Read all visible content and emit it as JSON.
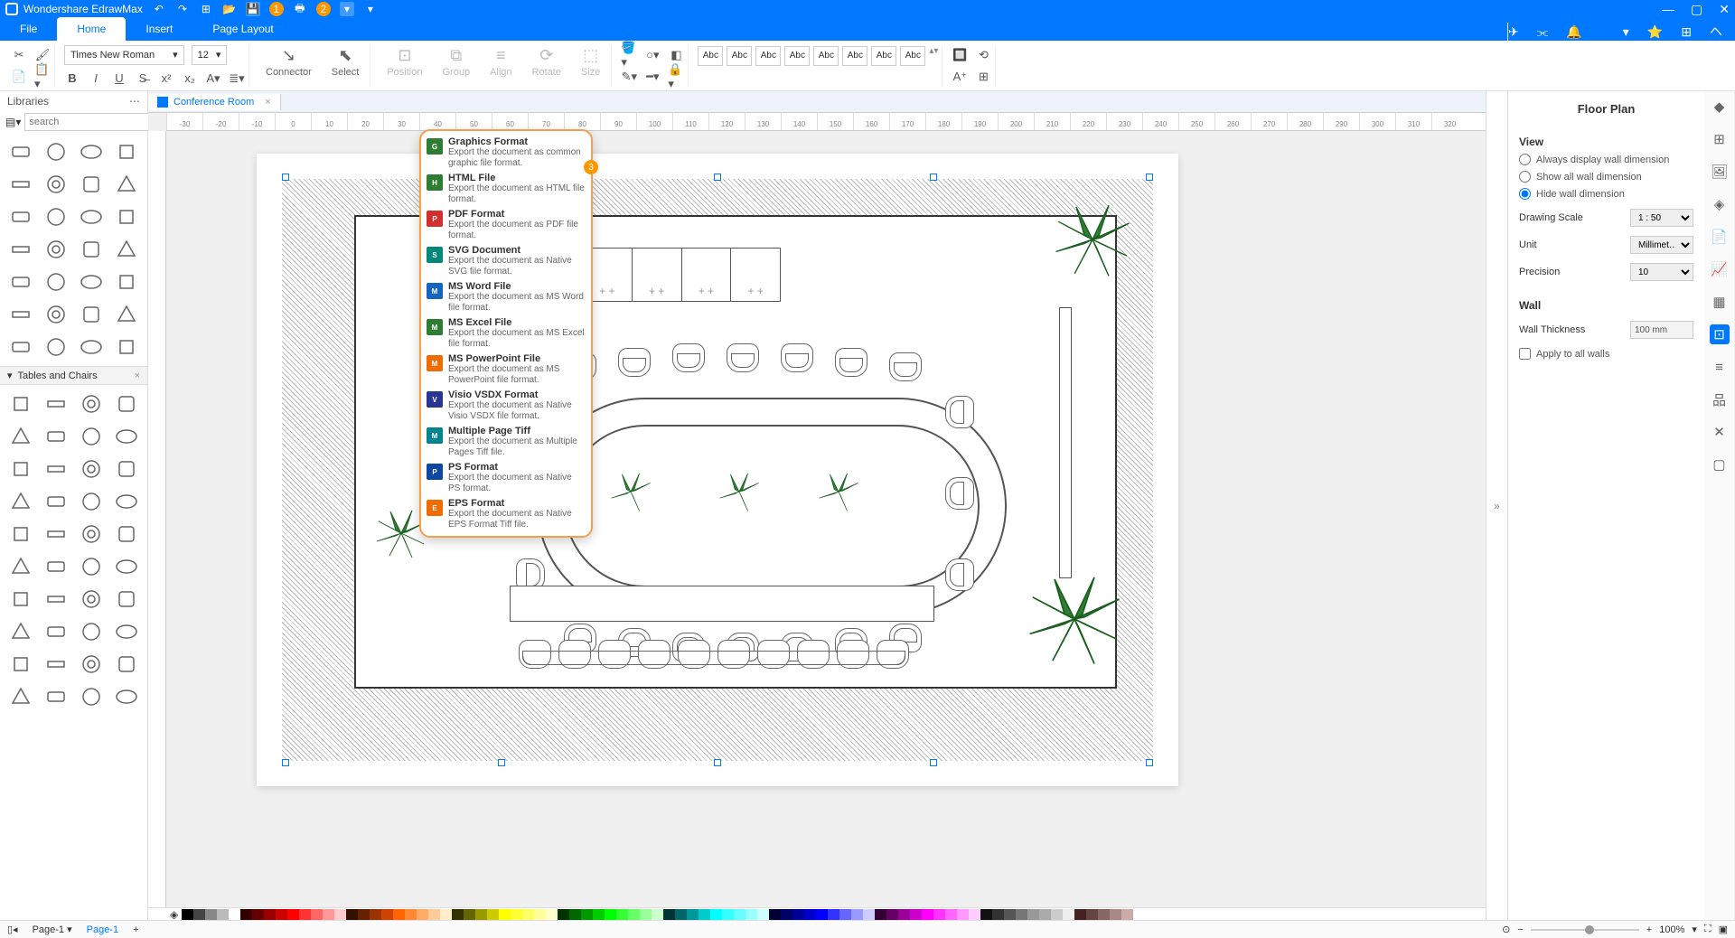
{
  "app_title": "Wondershare EdrawMax",
  "menu_tabs": [
    "File",
    "Home",
    "Insert",
    "Page Layout"
  ],
  "active_menu": "Home",
  "font_name": "Times New Roman",
  "font_size": "12",
  "ribbon_big": [
    {
      "label": "Connector",
      "disabled": false
    },
    {
      "label": "Select",
      "disabled": false
    },
    {
      "label": "Position",
      "disabled": true
    },
    {
      "label": "Group",
      "disabled": true
    },
    {
      "label": "Align",
      "disabled": true
    },
    {
      "label": "Rotate",
      "disabled": true
    },
    {
      "label": "Size",
      "disabled": true
    }
  ],
  "abc_label": "Abc",
  "libraries": {
    "title": "Libraries",
    "search_placeholder": "search",
    "section2": "Tables and Chairs"
  },
  "doc_tab": "Conference Room",
  "ruler_marks": [
    "-30",
    "-20",
    "-10",
    "0",
    "10",
    "20",
    "30",
    "40",
    "50",
    "60",
    "70",
    "80",
    "90",
    "100",
    "110",
    "120",
    "130",
    "140",
    "150",
    "160",
    "170",
    "180",
    "190",
    "200",
    "210",
    "220",
    "230",
    "240",
    "250",
    "260",
    "270",
    "280",
    "290",
    "300",
    "310",
    "320"
  ],
  "export_menu": [
    {
      "t": "Graphics Format",
      "d": "Export the document as common graphic file format.",
      "c": "#2e7d32"
    },
    {
      "t": "HTML File",
      "d": "Export the document as HTML file format.",
      "c": "#2e7d32"
    },
    {
      "t": "PDF Format",
      "d": "Export the document as PDF file format.",
      "c": "#d32f2f"
    },
    {
      "t": "SVG Document",
      "d": "Export the document as Native SVG file format.",
      "c": "#00897b"
    },
    {
      "t": "MS Word File",
      "d": "Export the document as MS Word file format.",
      "c": "#1565c0"
    },
    {
      "t": "MS Excel File",
      "d": "Export the document as MS Excel file format.",
      "c": "#2e7d32"
    },
    {
      "t": "MS PowerPoint File",
      "d": "Export the document as MS PowerPoint file format.",
      "c": "#ef6c00"
    },
    {
      "t": "Visio VSDX Format",
      "d": "Export the document as Native Visio VSDX file format.",
      "c": "#283593"
    },
    {
      "t": "Multiple Page Tiff",
      "d": "Export the document as Multiple Pages Tiff file.",
      "c": "#00838f"
    },
    {
      "t": "PS Format",
      "d": "Export the document as Native PS format.",
      "c": "#0d47a1"
    },
    {
      "t": "EPS Format",
      "d": "Export the document as Native EPS Format Tiff file.",
      "c": "#ef6c00"
    }
  ],
  "badge1": "1",
  "badge2": "2",
  "badge3": "3",
  "right_panel": {
    "title": "Floor Plan",
    "view_label": "View",
    "radios": [
      "Always display wall dimension",
      "Show all wall dimension",
      "Hide wall dimension"
    ],
    "radio_checked": 2,
    "scale_label": "Drawing Scale",
    "scale_val": "1 : 50",
    "unit_label": "Unit",
    "unit_val": "Millimet…",
    "prec_label": "Precision",
    "prec_val": "10",
    "wall_label": "Wall",
    "thick_label": "Wall Thickness",
    "thick_val": "100 mm",
    "apply_label": "Apply to all walls"
  },
  "status": {
    "page_sel": "Page-1",
    "page_tab": "Page-1",
    "zoom": "100%"
  },
  "colors": [
    "#000",
    "#444",
    "#888",
    "#bbb",
    "#fff",
    "#300",
    "#600",
    "#900",
    "#c00",
    "#f00",
    "#f33",
    "#f66",
    "#f99",
    "#fcc",
    "#310",
    "#620",
    "#930",
    "#c40",
    "#f60",
    "#f83",
    "#fa6",
    "#fc9",
    "#fec",
    "#330",
    "#660",
    "#990",
    "#cc0",
    "#ff0",
    "#ff3",
    "#ff6",
    "#ff9",
    "#ffc",
    "#030",
    "#060",
    "#090",
    "#0c0",
    "#0f0",
    "#3f3",
    "#6f6",
    "#9f9",
    "#cfc",
    "#033",
    "#066",
    "#099",
    "#0cc",
    "#0ff",
    "#3ff",
    "#6ff",
    "#9ff",
    "#cff",
    "#003",
    "#006",
    "#009",
    "#00c",
    "#00f",
    "#33f",
    "#66f",
    "#99f",
    "#ccf",
    "#303",
    "#606",
    "#909",
    "#c0c",
    "#f0f",
    "#f3f",
    "#f6f",
    "#f9f",
    "#fcf",
    "#111",
    "#333",
    "#555",
    "#777",
    "#999",
    "#aaa",
    "#ccc",
    "#eee",
    "#422",
    "#644",
    "#866",
    "#a88",
    "#caa"
  ]
}
